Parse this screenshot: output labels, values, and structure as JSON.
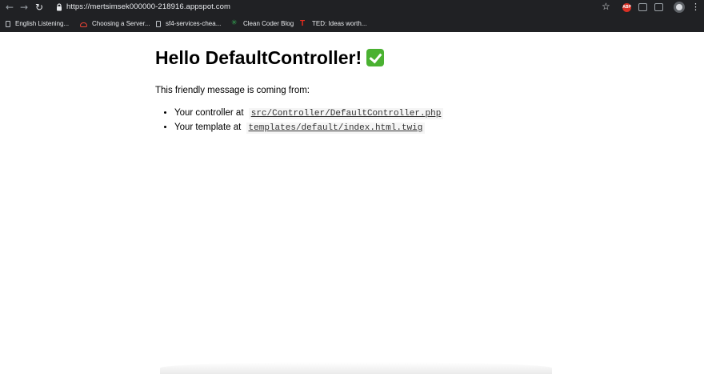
{
  "browser": {
    "url": "https://mertsimsek000000-218916.appspot.com",
    "extension_badge": "ABP",
    "bookmarks": [
      {
        "label": "English Listening...",
        "icon": "page-icon"
      },
      {
        "label": "Choosing a Server...",
        "icon": "cloud-icon"
      },
      {
        "label": "sf4-services-chea...",
        "icon": "page-icon"
      },
      {
        "label": "Clean Coder Blog",
        "icon": "star-icon"
      },
      {
        "label": "TED: Ideas worth...",
        "icon": "ted-icon"
      }
    ]
  },
  "page": {
    "title": "Hello DefaultController!",
    "title_icon": "check-mark-icon",
    "intro": "This friendly message is coming from:",
    "items": [
      {
        "prefix": "Your controller at",
        "path": "src/Controller/DefaultController.php"
      },
      {
        "prefix": "Your template at",
        "path": "templates/default/index.html.twig"
      }
    ]
  },
  "colors": {
    "chrome_bg": "#202124",
    "check_green": "#4ab131"
  }
}
